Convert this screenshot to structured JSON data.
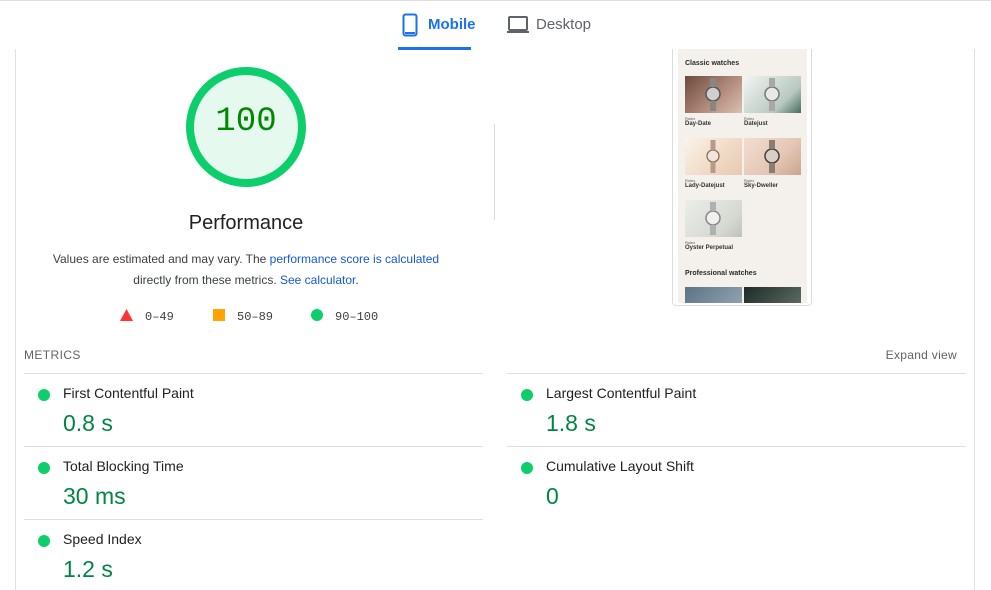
{
  "tabs": [
    {
      "label": "Mobile",
      "icon": "smartphone-icon",
      "active": true
    },
    {
      "label": "Desktop",
      "icon": "laptop-icon",
      "active": false
    }
  ],
  "colors": {
    "accent": "#1a73e8",
    "pass": "#0cce6b",
    "average": "#ffa400",
    "fail": "#ff4e42",
    "pass_text": "#018642"
  },
  "performance": {
    "score": "100",
    "title": "Performance",
    "desc_prefix": "Values are estimated and may vary. The ",
    "desc_link1": "performance score is calculated",
    "desc_middle": "directly from these metrics. ",
    "desc_link2": "See calculator",
    "desc_suffix": "."
  },
  "legend": [
    {
      "range": "0–49",
      "icon": "fail-triangle-icon"
    },
    {
      "range": "50–89",
      "icon": "average-square-icon"
    },
    {
      "range": "90–100",
      "icon": "pass-circle-icon"
    }
  ],
  "screenshot": {
    "section1_title": "Classic watches",
    "items": [
      {
        "brand": "Rolex",
        "name": "Day-Date"
      },
      {
        "brand": "Rolex",
        "name": "Datejust"
      },
      {
        "brand": "Rolex",
        "name": "Lady-Datejust"
      },
      {
        "brand": "Rolex",
        "name": "Sky-Dweller"
      },
      {
        "brand": "Rolex",
        "name": "Oyster Perpetual"
      }
    ],
    "section2_title": "Professional watches"
  },
  "metrics": {
    "heading": "METRICS",
    "expand_label": "Expand view",
    "items": [
      {
        "label": "First Contentful Paint",
        "value": "0.8 s"
      },
      {
        "label": "Largest Contentful Paint",
        "value": "1.8 s"
      },
      {
        "label": "Total Blocking Time",
        "value": "30 ms"
      },
      {
        "label": "Cumulative Layout Shift",
        "value": "0"
      },
      {
        "label": "Speed Index",
        "value": "1.2 s"
      }
    ]
  }
}
